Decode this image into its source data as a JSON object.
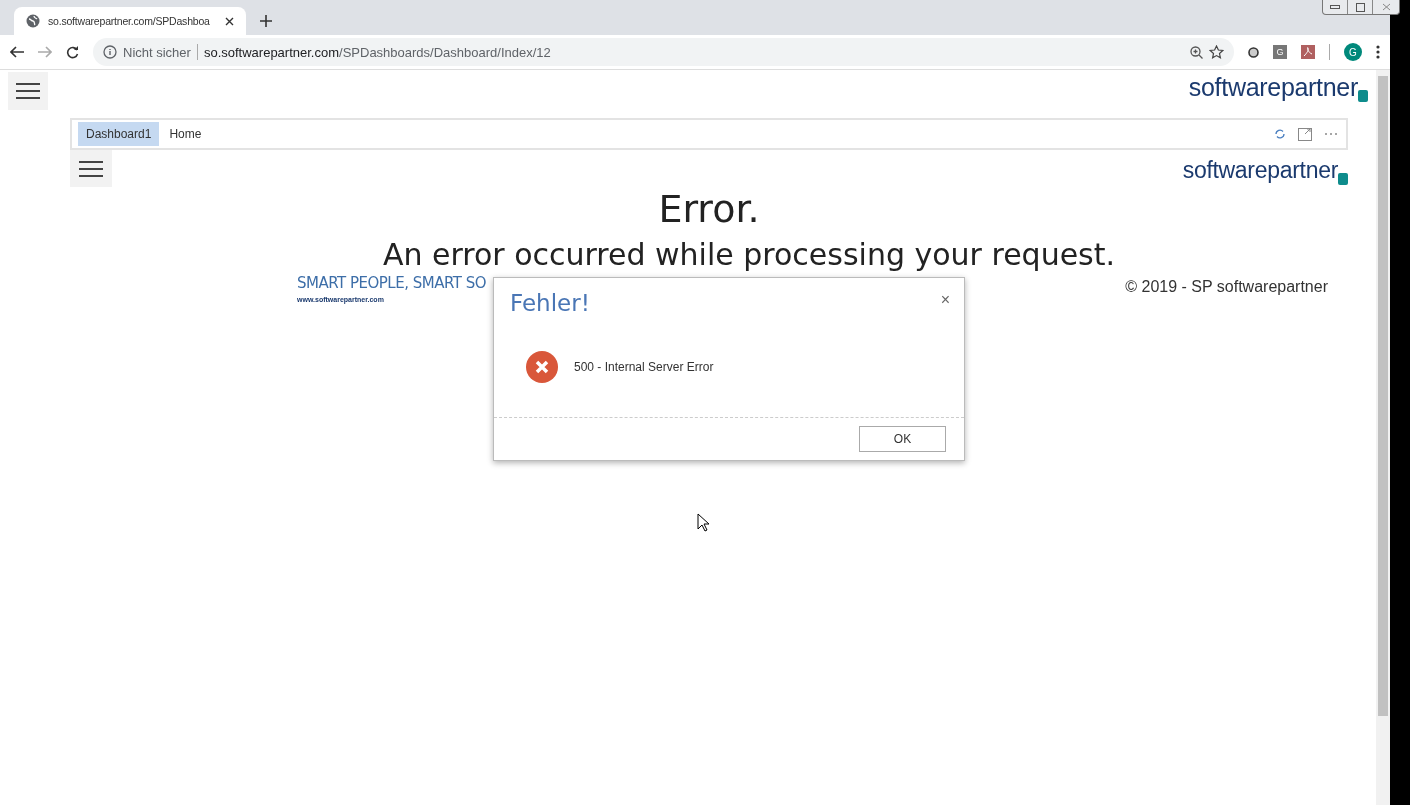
{
  "browser": {
    "tab_title": "so.softwarepartner.com/SPDashboa",
    "security": "Nicht sicher",
    "url_host": "so.softwarepartner.com",
    "url_path": "/SPDashboards/Dashboard/Index/12",
    "profile_initial": "G",
    "extension_initial": "G"
  },
  "page": {
    "logo": "softwarepartner",
    "dashboard_tabs": [
      {
        "label": "Dashboard1",
        "selected": true
      },
      {
        "label": "Home",
        "selected": false
      }
    ],
    "inner_logo": "softwarepartner",
    "error_title": "Error.",
    "error_message": "An error occurred while processing your request.",
    "slogan": "SMART PEOPLE, SMART SO",
    "website": "www.softwarepartner.com",
    "copyright": "© 2019 - SP softwarepartner"
  },
  "dialog": {
    "title": "Fehler!",
    "close": "×",
    "message": "500 - Internal Server Error",
    "button": "OK"
  }
}
